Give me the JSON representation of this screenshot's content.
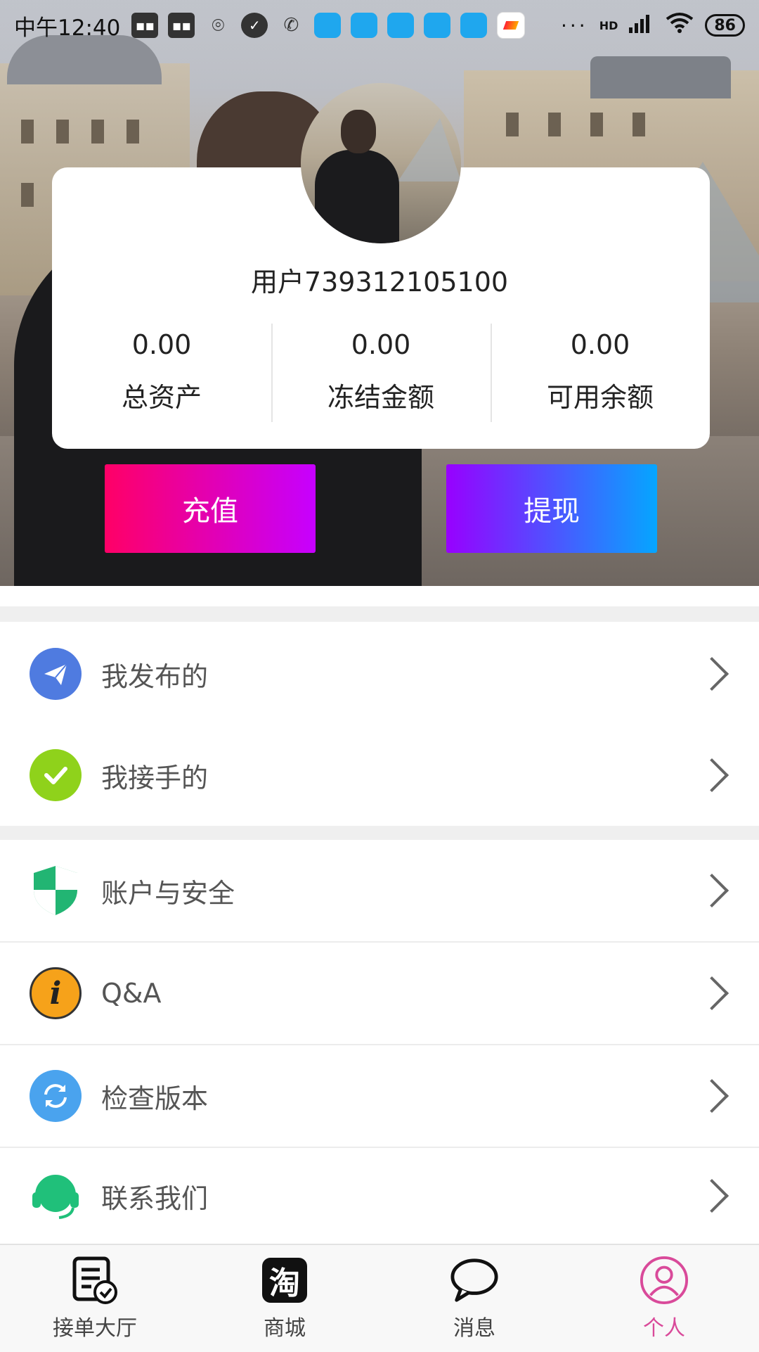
{
  "status_bar": {
    "time": "中午12:40",
    "more": "···",
    "network": "HD",
    "battery": "86"
  },
  "profile": {
    "username": "用户739312105100",
    "stats": [
      {
        "value": "0.00",
        "label": "总资产"
      },
      {
        "value": "0.00",
        "label": "冻结金额"
      },
      {
        "value": "0.00",
        "label": "可用余额"
      }
    ]
  },
  "actions": {
    "recharge": "充值",
    "withdraw": "提现"
  },
  "menu": {
    "group1": [
      {
        "label": "我发布的",
        "icon": "paper-plane-icon",
        "color": "#4f7be0"
      },
      {
        "label": "我接手的",
        "icon": "check-circle-icon",
        "color": "#8fd21b"
      }
    ],
    "group2": [
      {
        "label": "账户与安全",
        "icon": "shield-icon",
        "color": "#22b573"
      },
      {
        "label": "Q&A",
        "icon": "info-icon",
        "color": "#f6a21a"
      },
      {
        "label": "检查版本",
        "icon": "refresh-icon",
        "color": "#4aa3ee"
      },
      {
        "label": "联系我们",
        "icon": "headset-icon",
        "color": "#20c07a"
      }
    ]
  },
  "bottom_nav": {
    "items": [
      {
        "label": "接单大厅",
        "icon": "order-list-icon"
      },
      {
        "label": "商城",
        "icon": "taobao-icon"
      },
      {
        "label": "消息",
        "icon": "chat-bubble-icon"
      },
      {
        "label": "个人",
        "icon": "user-icon",
        "active": true
      }
    ],
    "active_color": "#d94a9a",
    "taobao_glyph": "淘"
  },
  "colors": {
    "recharge_gradient": [
      "#ff0066",
      "#c600ff"
    ],
    "withdraw_gradient": [
      "#9800ff",
      "#05a6ff"
    ]
  }
}
